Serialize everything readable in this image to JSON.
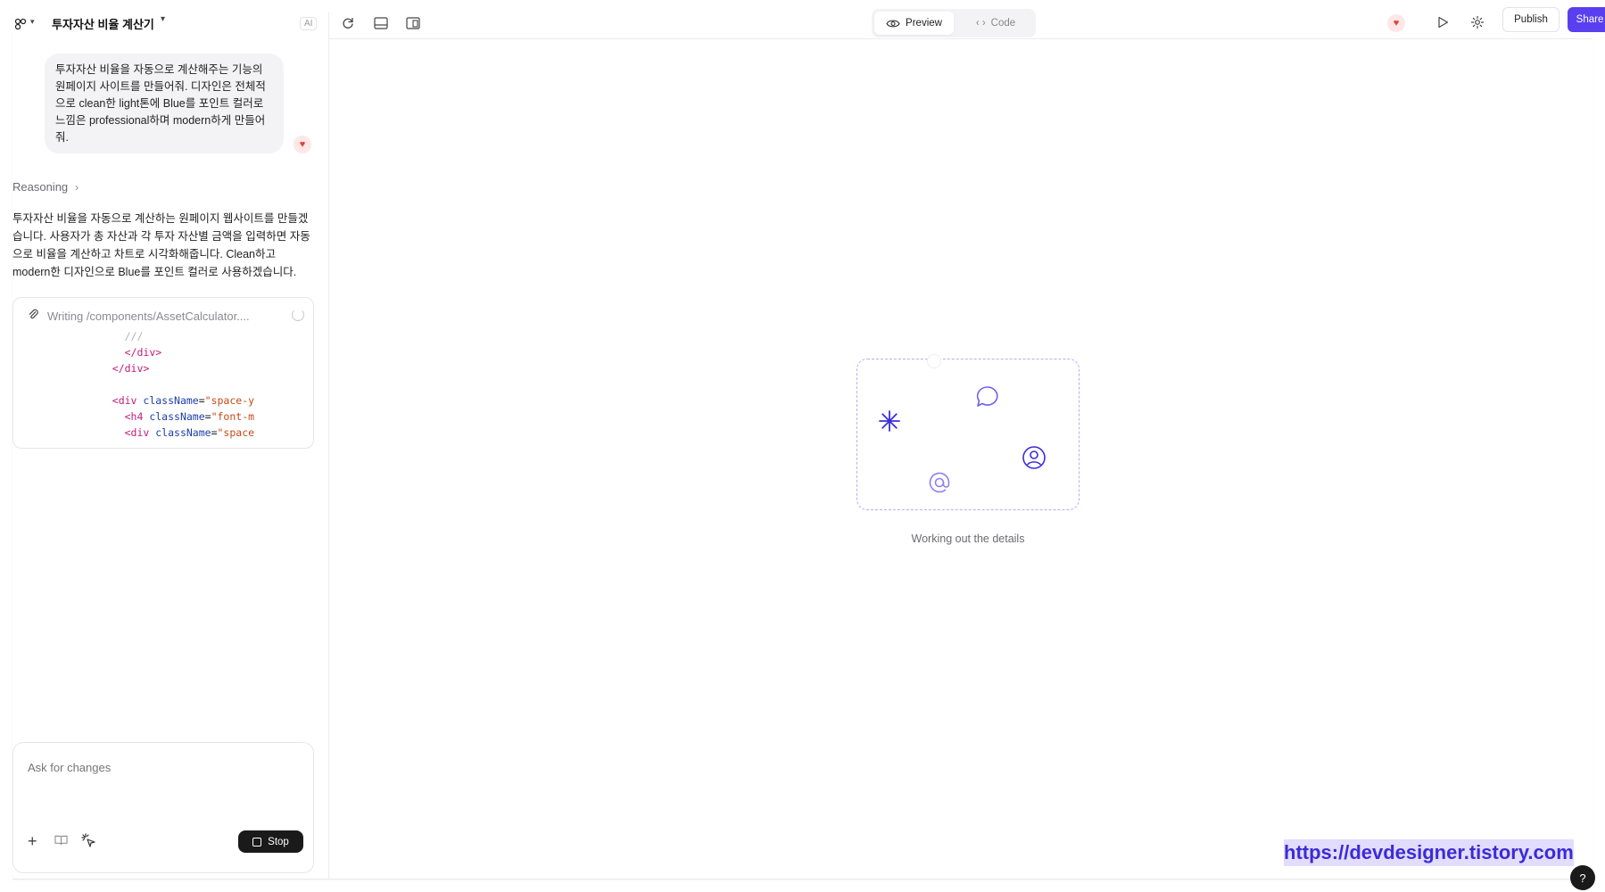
{
  "header": {
    "project_title": "투자자산 비율 계산기",
    "ai_badge": "AI"
  },
  "chat": {
    "user_message": "투자자산 비율을 자동으로 계산해주는 기능의 원페이지 사이트를 만들어줘. 디자인은 전체적으로 clean한 light톤에 Blue를 포인트 컬러로 느낌은 professional하며 modern하게 만들어줘.",
    "reasoning_label": "Reasoning",
    "assistant_reply": "투자자산 비율을 자동으로 계산하는 원페이지 웹사이트를 만들겠습니다. 사용자가 총 자산과 각 투자 자산별 금액을 입력하면 자동으로 비율을 계산하고 차트로 시각화해줍니다. Clean하고 modern한 디자인으로 Blue를 포인트 컬러로 사용하겠습니다.",
    "writing_status": "Writing /components/AssetCalculator....",
    "code_lines": [
      {
        "indent": "                  ",
        "parts": [
          {
            "t": "///",
            "c": "dim"
          }
        ]
      },
      {
        "indent": "                  ",
        "parts": [
          {
            "t": "</div>",
            "c": "tag"
          }
        ]
      },
      {
        "indent": "                ",
        "parts": [
          {
            "t": "</div>",
            "c": "tag"
          }
        ]
      },
      {
        "indent": "",
        "parts": []
      },
      {
        "indent": "                ",
        "parts": [
          {
            "t": "<div ",
            "c": "tag"
          },
          {
            "t": "className",
            "c": "attr"
          },
          {
            "t": "=",
            "c": ""
          },
          {
            "t": "\"space-y",
            "c": "str"
          }
        ]
      },
      {
        "indent": "                  ",
        "parts": [
          {
            "t": "<h4 ",
            "c": "tag"
          },
          {
            "t": "className",
            "c": "attr"
          },
          {
            "t": "=",
            "c": ""
          },
          {
            "t": "\"font-m",
            "c": "str"
          }
        ]
      },
      {
        "indent": "                  ",
        "parts": [
          {
            "t": "<div ",
            "c": "tag"
          },
          {
            "t": "className",
            "c": "attr"
          },
          {
            "t": "=",
            "c": ""
          },
          {
            "t": "\"space",
            "c": "str"
          }
        ]
      },
      {
        "indent": "                    ",
        "parts": [
          {
            "t": "<",
            "c": "dim"
          }
        ]
      }
    ],
    "input_placeholder": "Ask for changes",
    "stop_label": "Stop"
  },
  "toolbar": {
    "preview_label": "Preview",
    "code_label": "Code",
    "publish_label": "Publish",
    "share_label": "Share"
  },
  "preview": {
    "status_text": "Working out the details"
  },
  "watermark": "https://devdesigner.tistory.com",
  "help_label": "?",
  "colors": {
    "accent": "#5a3ff0",
    "placeholder_border": "#b8aef5",
    "icon_blue": "#3a2fd6"
  }
}
